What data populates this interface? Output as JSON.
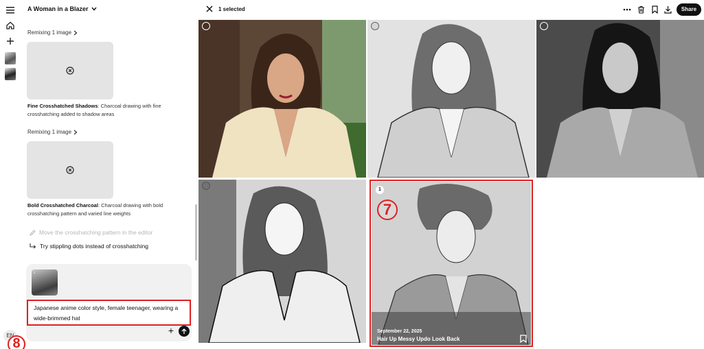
{
  "conversation": {
    "title": "A Woman in a Blazer"
  },
  "rail": {
    "language": "EN"
  },
  "messages": [
    {
      "remix_label": "Remixing 1 image",
      "result_title": "Fine Crosshatched Shadows",
      "result_desc": ": Charcoal drawing with fine crosshatching added to shadow areas"
    },
    {
      "remix_label": "Remixing 1 image",
      "result_title": "Bold Crosshatched Charcoal",
      "result_desc": ": Charcoal drawing with bold crosshatching pattern and varied line weights"
    }
  ],
  "suggestions": [
    "Move the crosshatching pattern in the editor",
    "Try stippling dots instead of crosshatching"
  ],
  "composer": {
    "attachment_count": "1",
    "prompt_text": "Japanese anime color style, female teenager, wearing a wide-brimmed hat",
    "annotation_label": "8"
  },
  "gallery": {
    "selected_label": "1 selected",
    "share_label": "Share",
    "selected_tile": {
      "selection_number": "1",
      "annotation_label": "7",
      "date": "September 22, 2025",
      "caption": "Hair Up Messy Updo Look Back"
    }
  },
  "colors": {
    "annotation_red": "#e02020",
    "share_bg": "#111111",
    "composer_bg": "#f1f1f1",
    "placeholder_card": "#e4e4e4"
  }
}
